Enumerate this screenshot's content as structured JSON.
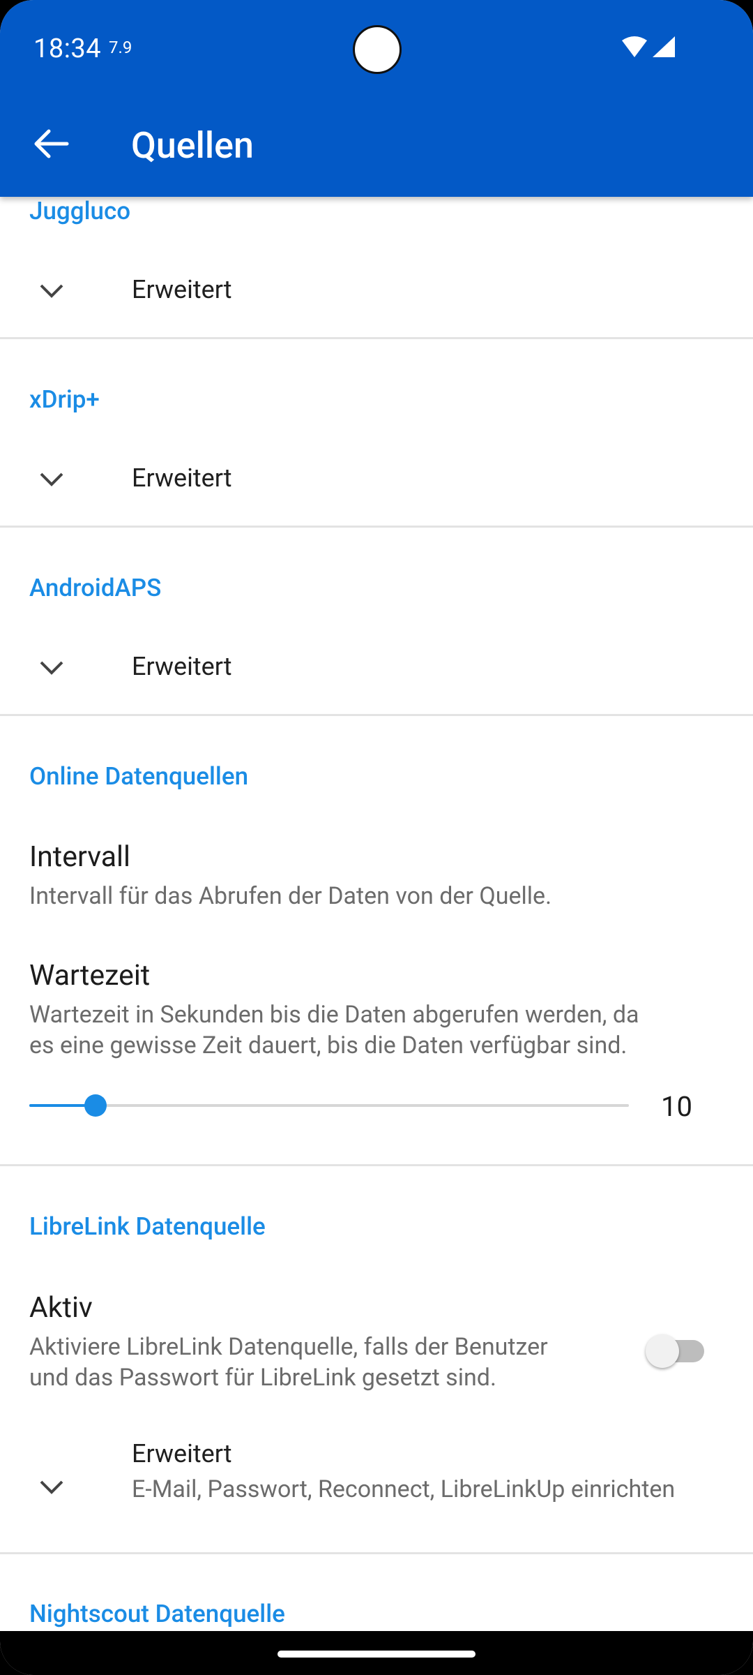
{
  "status_bar": {
    "time": "18:34",
    "extra": "7.9"
  },
  "app_bar": {
    "title": "Quellen",
    "back_icon": "arrow-back-icon"
  },
  "sections": {
    "juggluco": {
      "title": "Juggluco",
      "advanced_label": "Erweitert"
    },
    "xdrip": {
      "title": "xDrip+",
      "advanced_label": "Erweitert"
    },
    "aaps": {
      "title": "AndroidAPS",
      "advanced_label": "Erweitert"
    },
    "online": {
      "title": "Online Datenquellen",
      "interval": {
        "title": "Intervall",
        "summary": "Intervall für das Abrufen der Daten von der Quelle."
      },
      "wait": {
        "title": "Wartezeit",
        "summary_line1": "Wartezeit in Sekunden bis die Daten abgerufen werden, da",
        "summary_line2": "es eine gewisse Zeit dauert, bis die Daten verfügbar sind.",
        "slider_value": "10",
        "slider_fraction": 0.11
      }
    },
    "librelink": {
      "title": "LibreLink Datenquelle",
      "active": {
        "title": "Aktiv",
        "summary_line1": "Aktiviere LibreLink Datenquelle, falls der Benutzer",
        "summary_line2": "und das Passwort für LibreLink gesetzt sind.",
        "enabled": false
      },
      "advanced": {
        "label": "Erweitert",
        "summary": "E-Mail, Passwort, Reconnect, LibreLinkUp einrichten"
      }
    },
    "nightscout": {
      "title": "Nightscout Datenquelle"
    }
  },
  "colors": {
    "app_bar": "#0359C6",
    "accent": "#1A8CE5"
  }
}
